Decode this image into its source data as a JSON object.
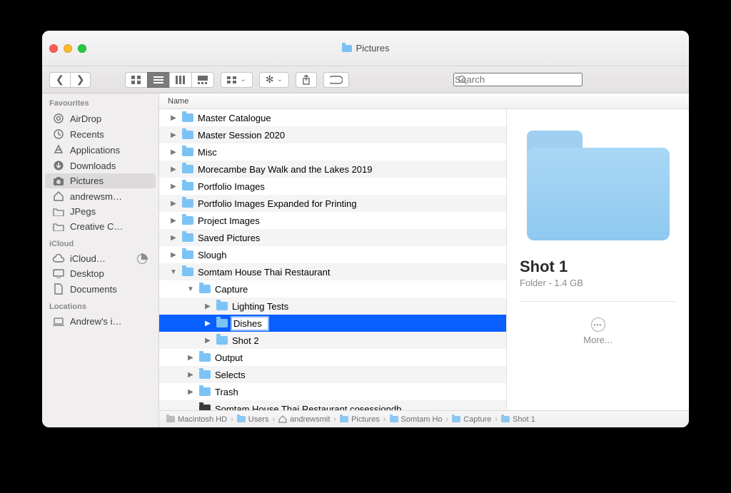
{
  "title": "Pictures",
  "search": {
    "placeholder": "Search"
  },
  "sidebar": {
    "sections": [
      {
        "title": "Favourites",
        "items": [
          {
            "label": "AirDrop",
            "icon": "airdrop"
          },
          {
            "label": "Recents",
            "icon": "clock"
          },
          {
            "label": "Applications",
            "icon": "apps"
          },
          {
            "label": "Downloads",
            "icon": "download"
          },
          {
            "label": "Pictures",
            "icon": "camera",
            "selected": true
          },
          {
            "label": "andrewsm…",
            "icon": "home"
          },
          {
            "label": "JPegs",
            "icon": "folder"
          },
          {
            "label": "Creative C…",
            "icon": "folder"
          }
        ]
      },
      {
        "title": "iCloud",
        "items": [
          {
            "label": "iCloud…",
            "icon": "cloud",
            "pie": true
          },
          {
            "label": "Desktop",
            "icon": "desktop"
          },
          {
            "label": "Documents",
            "icon": "doc"
          }
        ]
      },
      {
        "title": "Locations",
        "items": [
          {
            "label": "Andrew's i…",
            "icon": "laptop"
          }
        ]
      }
    ]
  },
  "list": {
    "header": "Name",
    "rows": [
      {
        "label": "Master Catalogue",
        "indent": 0,
        "tri": "right"
      },
      {
        "label": "Master Session 2020",
        "indent": 0,
        "tri": "right"
      },
      {
        "label": "Misc",
        "indent": 0,
        "tri": "right"
      },
      {
        "label": "Morecambe Bay Walk and the Lakes 2019",
        "indent": 0,
        "tri": "right"
      },
      {
        "label": "Portfolio Images",
        "indent": 0,
        "tri": "right"
      },
      {
        "label": "Portfolio Images Expanded for Printing",
        "indent": 0,
        "tri": "right"
      },
      {
        "label": "Project Images",
        "indent": 0,
        "tri": "right"
      },
      {
        "label": "Saved Pictures",
        "indent": 0,
        "tri": "right"
      },
      {
        "label": "Slough",
        "indent": 0,
        "tri": "right"
      },
      {
        "label": "Somtam House Thai Restaurant",
        "indent": 0,
        "tri": "down"
      },
      {
        "label": "Capture",
        "indent": 1,
        "tri": "down"
      },
      {
        "label": "Lighting Tests",
        "indent": 2,
        "tri": "right"
      },
      {
        "label": "Dishes",
        "indent": 2,
        "tri": "right",
        "selected": true,
        "editing": true
      },
      {
        "label": "Shot 2",
        "indent": 2,
        "tri": "right"
      },
      {
        "label": "Output",
        "indent": 1,
        "tri": "right"
      },
      {
        "label": "Selects",
        "indent": 1,
        "tri": "right"
      },
      {
        "label": "Trash",
        "indent": 1,
        "tri": "right"
      },
      {
        "label": "Somtam House Thai Restaurant.cosessiondb",
        "indent": 1,
        "tri": "none",
        "dark": true
      }
    ]
  },
  "preview": {
    "name": "Shot 1",
    "meta": "Folder - 1.4 GB",
    "more": "More..."
  },
  "path": [
    "Macintosh HD",
    "Users",
    "andrewsmit",
    "Pictures",
    "Somtam Ho",
    "Capture",
    "Shot 1"
  ]
}
